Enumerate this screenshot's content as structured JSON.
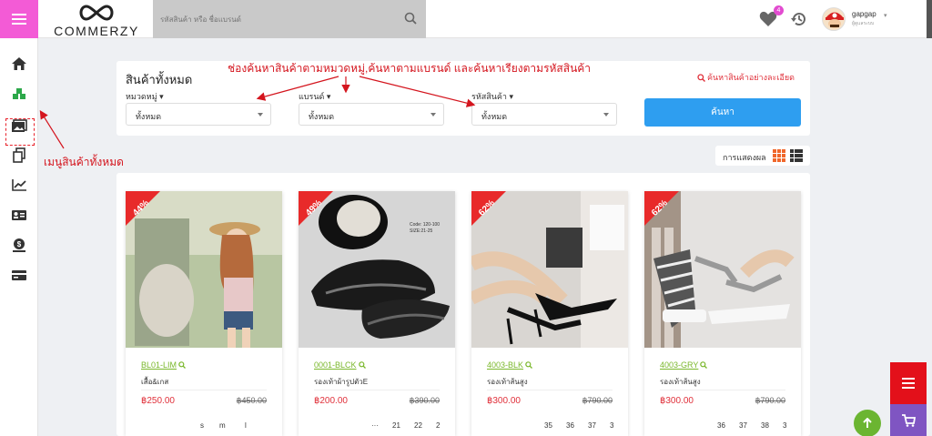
{
  "header": {
    "logo_text": "COMMERZY",
    "search_placeholder": "รหัสสินค้า หรือ ชื่อแบรนด์",
    "wishlist_count": "4",
    "user_name": "gapgap",
    "user_role": "ผู้ดูแลระบบ"
  },
  "filter": {
    "title": "สินค้าทั้งหมด",
    "advanced_link": "ค้นหาสินค้าอย่างละเอียด",
    "category_label": "หมวดหมู่",
    "brand_label": "แบรนด์",
    "code_label": "รหัสสินค้า",
    "category_value": "ทั้งหมด",
    "brand_value": "ทั้งหมด",
    "code_value": "ทั้งหมด",
    "search_button": "ค้นหา"
  },
  "annotations": {
    "top": "ช่องค้นหาสินค้าตามหมวดหมู่,ค้นหาตามแบรนด์ และค้นหาเรียงตามรหัสสินค้า",
    "left": "เมนูสินค้าทั้งหมด"
  },
  "view": {
    "label": "การแสดงผล"
  },
  "products": [
    {
      "discount": "44%",
      "code": "BL01-LIM",
      "name": "เสื้อ&เกส",
      "price": "฿250.00",
      "old_price": "฿450.00",
      "sizes": [
        "s",
        "m",
        "l"
      ]
    },
    {
      "discount": "49%",
      "code": "0001-BLCK",
      "name": "รองเท้าผ้ารูปตัวE",
      "price": "฿200.00",
      "old_price": "฿390.00",
      "sizes": [
        "···",
        "21",
        "22",
        "2"
      ]
    },
    {
      "discount": "62%",
      "code": "4003-BLK",
      "name": "รองเท้าส้นสูง",
      "price": "฿300.00",
      "old_price": "฿790.00",
      "sizes": [
        "35",
        "36",
        "37",
        "3"
      ]
    },
    {
      "discount": "62%",
      "code": "4003-GRY",
      "name": "รองเท้าส้นสูง",
      "price": "฿300.00",
      "old_price": "฿790.00",
      "sizes": [
        "36",
        "37",
        "38",
        "3"
      ]
    }
  ],
  "colors": {
    "menu_pink": "#f35bd6",
    "primary_blue": "#2e9ef0",
    "discount_red": "#e82a2a",
    "code_green": "#79b72a",
    "annotation_red": "#d4151e"
  }
}
